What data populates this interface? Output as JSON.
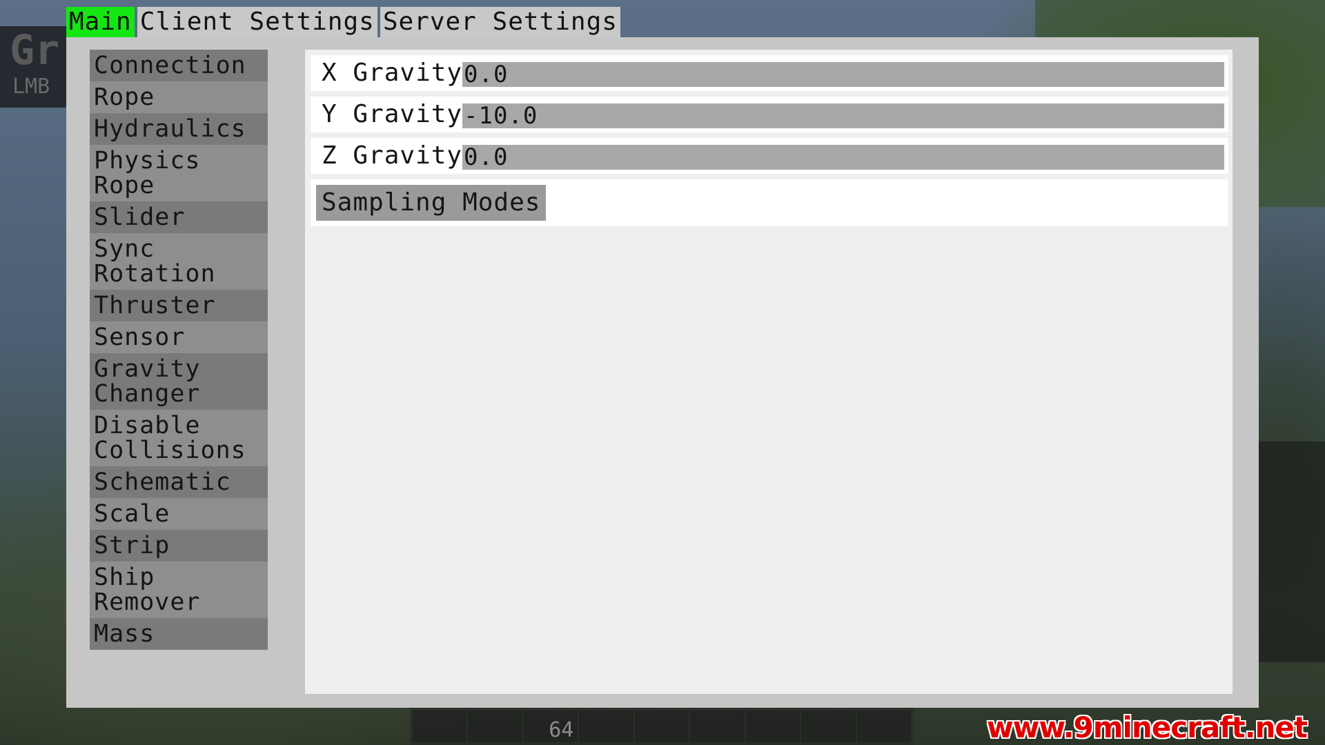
{
  "hud": {
    "title": "Gr",
    "subtitle": "LMB"
  },
  "tabs": [
    {
      "label": "Main",
      "active": true
    },
    {
      "label": "Client Settings",
      "active": false
    },
    {
      "label": "Server Settings",
      "active": false
    }
  ],
  "sidebar": {
    "items": [
      {
        "label": "Connection"
      },
      {
        "label": "Rope"
      },
      {
        "label": "Hydraulics"
      },
      {
        "label": "Physics Rope"
      },
      {
        "label": "Slider"
      },
      {
        "label": "Sync Rotation"
      },
      {
        "label": "Thruster"
      },
      {
        "label": "Sensor"
      },
      {
        "label": "Gravity Changer"
      },
      {
        "label": "Disable Collisions"
      },
      {
        "label": "Schematic"
      },
      {
        "label": "Scale"
      },
      {
        "label": "Strip"
      },
      {
        "label": "Ship Remover"
      },
      {
        "label": "Mass"
      }
    ]
  },
  "settings": {
    "x_gravity": {
      "label": "X Gravity",
      "value": "0.0"
    },
    "y_gravity": {
      "label": "Y Gravity",
      "value": "-10.0"
    },
    "z_gravity": {
      "label": "Z Gravity",
      "value": "0.0"
    },
    "sampling_modes_label": "Sampling Modes"
  },
  "hotbar": {
    "slot3_count": "64"
  },
  "watermark": "www.9minecraft.net",
  "colors": {
    "active_tab": "#14e614",
    "panel": "#c6c6c6",
    "content": "#efefef",
    "input": "#a8a8a8"
  }
}
